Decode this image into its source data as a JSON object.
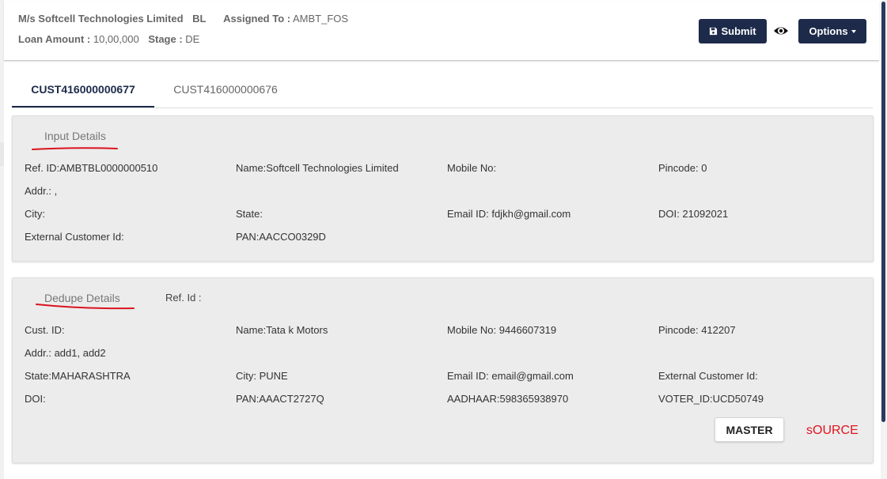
{
  "header": {
    "company": "M/s Softcell Technologies Limited",
    "product": "BL",
    "assigned_label": "Assigned To :",
    "assigned_value": "AMBT_FOS",
    "loan_label": "Loan Amount :",
    "loan_value": "10,00,000",
    "stage_label": "Stage :",
    "stage_value": "DE",
    "submit_label": "Submit",
    "options_label": "Options",
    "icons": [
      "save-icon",
      "eye-icon",
      "caret-down-icon"
    ]
  },
  "tabs": [
    {
      "label": "CUST416000000677",
      "active": true
    },
    {
      "label": "CUST416000000676",
      "active": false
    }
  ],
  "input_details": {
    "title": "Input Details",
    "fields": {
      "ref_id": "Ref. ID:AMBTBL0000000510",
      "name": "Name:Softcell Technologies Limited",
      "mobile": "Mobile No:",
      "pincode": "Pincode: 0",
      "addr": "Addr.: ,",
      "city": "City:",
      "state": "State:",
      "email": "Email ID: fdjkh@gmail.com",
      "doi": "DOI: 21092021",
      "ext_cust_id": "External Customer Id:",
      "pan": "PAN:AACCO0329D"
    }
  },
  "dedupe_details": {
    "title": "Dedupe Details",
    "ref_id_label": "Ref. Id :",
    "fields": {
      "cust_id": "Cust. ID:",
      "name": "Name:Tata k Motors",
      "mobile": "Mobile No: 9446607319",
      "pincode": "Pincode: 412207",
      "addr": "Addr.: add1, add2",
      "state": "State:MAHARASHTRA",
      "city": "City: PUNE",
      "email": "Email ID: email@gmail.com",
      "ext_cust_id": "External Customer Id:",
      "doi": "DOI:",
      "pan": "PAN:AAACT2727Q",
      "aadhaar": "AADHAAR:598365938970",
      "voter_id": "VOTER_ID:UCD50749"
    },
    "master_label": "MASTER",
    "source_label": "sOURCE"
  },
  "colors": {
    "primary": "#1d2a4a",
    "card_bg": "#ececec",
    "source_red": "#e0141e",
    "annotation_red": "#d9141e"
  }
}
